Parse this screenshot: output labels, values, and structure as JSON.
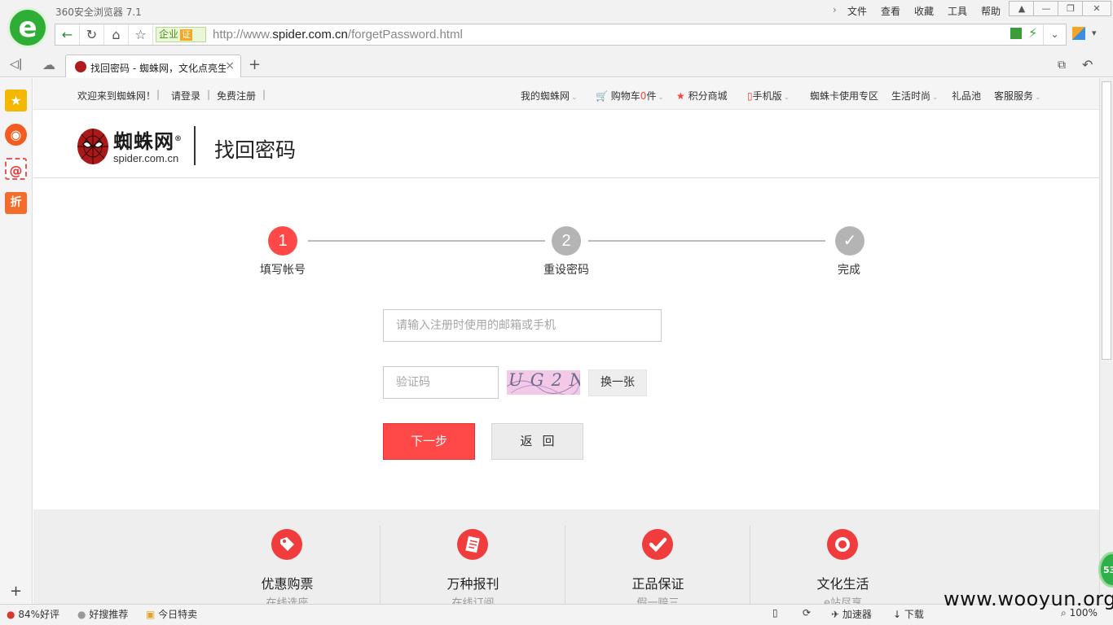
{
  "browser": {
    "app_title": "360安全浏览器 7.1",
    "menu": [
      "文件",
      "查看",
      "收藏",
      "工具",
      "帮助"
    ],
    "enterprise_label": "企业",
    "cert_label": "证",
    "url_prefix": "http://www.",
    "url_host": "spider.com.cn",
    "url_path": "/forgetPassword.html",
    "tab_title": "找回密码 - 蜘蛛网，文化点亮生活",
    "new_tab": "+"
  },
  "site": {
    "topbar": {
      "welcome": "欢迎来到蜘蛛网！",
      "login": "请登录",
      "register": "免费注册",
      "my_spider": "我的蜘蛛网",
      "cart_prefix": "购物车",
      "cart_count": "0",
      "cart_suffix": "件",
      "points_mall": "积分商城",
      "mobile": "手机版",
      "card_zone": "蜘蛛卡使用专区",
      "life_fashion": "生活时尚",
      "gift_pool": "礼品池",
      "customer_service": "客服服务"
    },
    "brand_cn": "蜘蛛网",
    "brand_reg": "®",
    "brand_en": "spider.com.cn",
    "page_title": "找回密码"
  },
  "steps": [
    {
      "num": "1",
      "label": "填写帐号",
      "state": "active"
    },
    {
      "num": "2",
      "label": "重设密码",
      "state": "pending"
    },
    {
      "num": "✓",
      "label": "完成",
      "state": "pending"
    }
  ],
  "form": {
    "account_placeholder": "请输入注册时使用的邮箱或手机",
    "captcha_placeholder": "验证码",
    "captcha_text": "UG2N",
    "swap_label": "换一张",
    "next_label": "下一步",
    "back_label": "返回"
  },
  "services": [
    {
      "title": "优惠购票",
      "sub": "在线选座",
      "icon": "tag-icon"
    },
    {
      "title": "万种报刊",
      "sub": "在线订阅",
      "icon": "newspaper-icon"
    },
    {
      "title": "正品保证",
      "sub": "假一赔三",
      "icon": "checkmark-icon"
    },
    {
      "title": "文化生活",
      "sub": "e站尽享",
      "icon": "culture-icon"
    }
  ],
  "statusbar": {
    "rating": "84%好评",
    "recommend": "好搜推荐",
    "today_sale": "今日特卖",
    "accelerator": "加速器",
    "download": "下载",
    "zoom": "100%",
    "green_ball": "53"
  },
  "watermark": "www.wooyun.org",
  "colors": {
    "accent_red": "#ff4848",
    "browser_green": "#2fae36",
    "step_grey": "#b4b4b4"
  }
}
